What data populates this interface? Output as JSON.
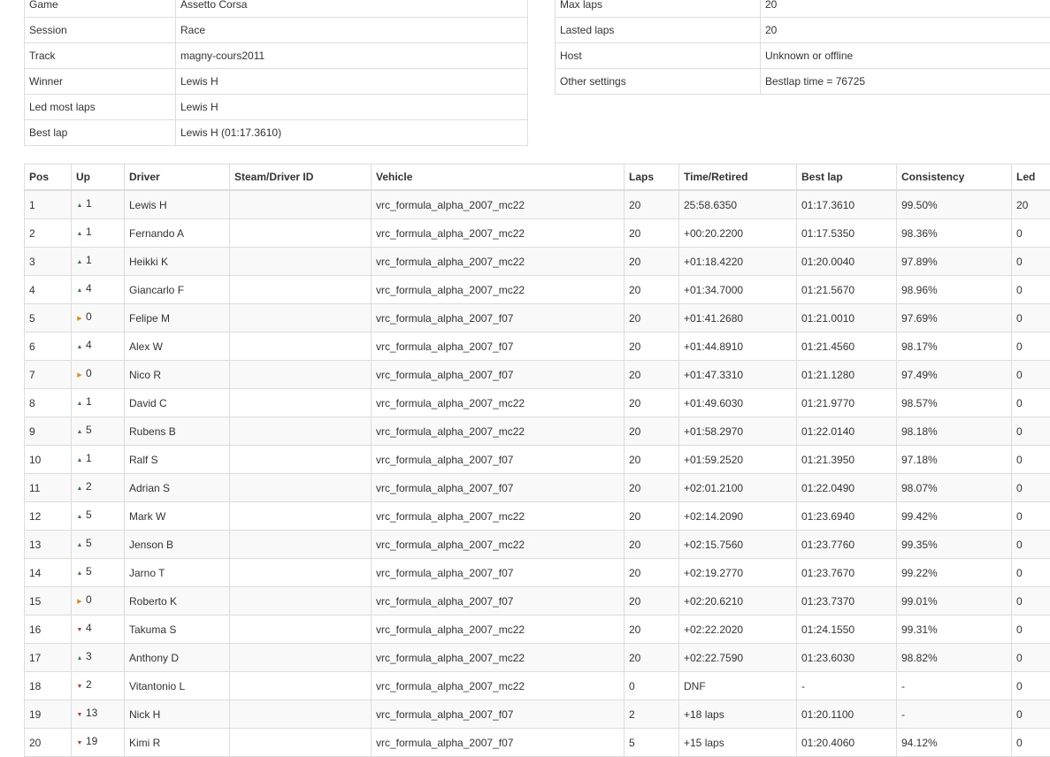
{
  "session_info_left": [
    {
      "key": "Game",
      "value": "Assetto Corsa"
    },
    {
      "key": "Session",
      "value": "Race"
    },
    {
      "key": "Track",
      "value": "magny-cours2011"
    },
    {
      "key": "Winner",
      "value": "Lewis H"
    },
    {
      "key": "Led most laps",
      "value": "Lewis H"
    },
    {
      "key": "Best lap",
      "value": "Lewis H (01:17.3610)"
    }
  ],
  "session_info_right": [
    {
      "key": "Max laps",
      "value": "20"
    },
    {
      "key": "Lasted laps",
      "value": "20"
    },
    {
      "key": "Host",
      "value": "Unknown or offline"
    },
    {
      "key": "Other settings",
      "value": "Bestlap time = 76725"
    }
  ],
  "results_table": {
    "headers": [
      "Pos",
      "Up",
      "Driver",
      "Steam/Driver ID",
      "Vehicle",
      "Laps",
      "Time/Retired",
      "Best lap",
      "Consistency",
      "Led"
    ],
    "arrow_colors": {
      "up": "#3c7d3c",
      "down": "#c0392b",
      "same": "#e08a1e"
    },
    "rows": [
      {
        "pos": "1",
        "dir": "up",
        "up": "1",
        "driver": "Lewis H",
        "id": "",
        "vehicle": "vrc_formula_alpha_2007_mc22",
        "laps": "20",
        "time": "25:58.6350",
        "best": "01:17.3610",
        "consistency": "99.50%",
        "led": "20"
      },
      {
        "pos": "2",
        "dir": "up",
        "up": "1",
        "driver": "Fernando A",
        "id": "",
        "vehicle": "vrc_formula_alpha_2007_mc22",
        "laps": "20",
        "time": "+00:20.2200",
        "best": "01:17.5350",
        "consistency": "98.36%",
        "led": "0"
      },
      {
        "pos": "3",
        "dir": "up",
        "up": "1",
        "driver": "Heikki K",
        "id": "",
        "vehicle": "vrc_formula_alpha_2007_mc22",
        "laps": "20",
        "time": "+01:18.4220",
        "best": "01:20.0040",
        "consistency": "97.89%",
        "led": "0"
      },
      {
        "pos": "4",
        "dir": "up",
        "up": "4",
        "driver": "Giancarlo F",
        "id": "",
        "vehicle": "vrc_formula_alpha_2007_mc22",
        "laps": "20",
        "time": "+01:34.7000",
        "best": "01:21.5670",
        "consistency": "98.96%",
        "led": "0"
      },
      {
        "pos": "5",
        "dir": "same",
        "up": "0",
        "driver": "Felipe M",
        "id": "",
        "vehicle": "vrc_formula_alpha_2007_f07",
        "laps": "20",
        "time": "+01:41.2680",
        "best": "01:21.0010",
        "consistency": "97.69%",
        "led": "0"
      },
      {
        "pos": "6",
        "dir": "up",
        "up": "4",
        "driver": "Alex W",
        "id": "",
        "vehicle": "vrc_formula_alpha_2007_f07",
        "laps": "20",
        "time": "+01:44.8910",
        "best": "01:21.4560",
        "consistency": "98.17%",
        "led": "0"
      },
      {
        "pos": "7",
        "dir": "same",
        "up": "0",
        "driver": "Nico R",
        "id": "",
        "vehicle": "vrc_formula_alpha_2007_f07",
        "laps": "20",
        "time": "+01:47.3310",
        "best": "01:21.1280",
        "consistency": "97.49%",
        "led": "0"
      },
      {
        "pos": "8",
        "dir": "up",
        "up": "1",
        "driver": "David C",
        "id": "",
        "vehicle": "vrc_formula_alpha_2007_mc22",
        "laps": "20",
        "time": "+01:49.6030",
        "best": "01:21.9770",
        "consistency": "98.57%",
        "led": "0"
      },
      {
        "pos": "9",
        "dir": "up",
        "up": "5",
        "driver": "Rubens B",
        "id": "",
        "vehicle": "vrc_formula_alpha_2007_mc22",
        "laps": "20",
        "time": "+01:58.2970",
        "best": "01:22.0140",
        "consistency": "98.18%",
        "led": "0"
      },
      {
        "pos": "10",
        "dir": "up",
        "up": "1",
        "driver": "Ralf S",
        "id": "",
        "vehicle": "vrc_formula_alpha_2007_f07",
        "laps": "20",
        "time": "+01:59.2520",
        "best": "01:21.3950",
        "consistency": "97.18%",
        "led": "0"
      },
      {
        "pos": "11",
        "dir": "up",
        "up": "2",
        "driver": "Adrian S",
        "id": "",
        "vehicle": "vrc_formula_alpha_2007_f07",
        "laps": "20",
        "time": "+02:01.2100",
        "best": "01:22.0490",
        "consistency": "98.07%",
        "led": "0"
      },
      {
        "pos": "12",
        "dir": "up",
        "up": "5",
        "driver": "Mark W",
        "id": "",
        "vehicle": "vrc_formula_alpha_2007_mc22",
        "laps": "20",
        "time": "+02:14.2090",
        "best": "01:23.6940",
        "consistency": "99.42%",
        "led": "0"
      },
      {
        "pos": "13",
        "dir": "up",
        "up": "5",
        "driver": "Jenson B",
        "id": "",
        "vehicle": "vrc_formula_alpha_2007_mc22",
        "laps": "20",
        "time": "+02:15.7560",
        "best": "01:23.7760",
        "consistency": "99.35%",
        "led": "0"
      },
      {
        "pos": "14",
        "dir": "up",
        "up": "5",
        "driver": "Jarno T",
        "id": "",
        "vehicle": "vrc_formula_alpha_2007_f07",
        "laps": "20",
        "time": "+02:19.2770",
        "best": "01:23.7670",
        "consistency": "99.22%",
        "led": "0"
      },
      {
        "pos": "15",
        "dir": "same",
        "up": "0",
        "driver": "Roberto K",
        "id": "",
        "vehicle": "vrc_formula_alpha_2007_f07",
        "laps": "20",
        "time": "+02:20.6210",
        "best": "01:23.7370",
        "consistency": "99.01%",
        "led": "0"
      },
      {
        "pos": "16",
        "dir": "down",
        "up": "4",
        "driver": "Takuma S",
        "id": "",
        "vehicle": "vrc_formula_alpha_2007_mc22",
        "laps": "20",
        "time": "+02:22.2020",
        "best": "01:24.1550",
        "consistency": "99.31%",
        "led": "0"
      },
      {
        "pos": "17",
        "dir": "up",
        "up": "3",
        "driver": "Anthony D",
        "id": "",
        "vehicle": "vrc_formula_alpha_2007_mc22",
        "laps": "20",
        "time": "+02:22.7590",
        "best": "01:23.6030",
        "consistency": "98.82%",
        "led": "0"
      },
      {
        "pos": "18",
        "dir": "down",
        "up": "2",
        "driver": "Vitantonio L",
        "id": "",
        "vehicle": "vrc_formula_alpha_2007_mc22",
        "laps": "0",
        "time": "DNF",
        "best": "-",
        "consistency": "-",
        "led": "0"
      },
      {
        "pos": "19",
        "dir": "down",
        "up": "13",
        "driver": "Nick H",
        "id": "",
        "vehicle": "vrc_formula_alpha_2007_f07",
        "laps": "2",
        "time": "+18 laps",
        "best": "01:20.1100",
        "consistency": "-",
        "led": "0"
      },
      {
        "pos": "20",
        "dir": "down",
        "up": "19",
        "driver": "Kimi R",
        "id": "",
        "vehicle": "vrc_formula_alpha_2007_f07",
        "laps": "5",
        "time": "+15 laps",
        "best": "01:20.4060",
        "consistency": "94.12%",
        "led": "0"
      }
    ]
  }
}
